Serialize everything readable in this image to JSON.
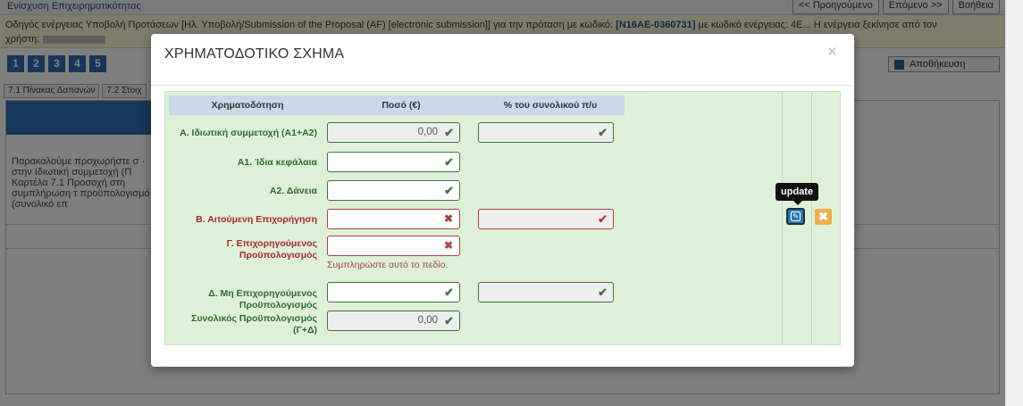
{
  "background": {
    "breadcrumb": "Ενίσχυση Επιχειρηματικότητας",
    "nav": {
      "prev": "<< Προηγούμενο",
      "next": "Επόμενο >>",
      "help": "Βοήθεια"
    },
    "info_line1": "Οδηγός ενέργειας Υποβολή Προτάσεων [Ηλ. Υποβολή/Submission of the Proposal (AF) [electronic submission]] για την πρόταση με κωδικό:",
    "proposal_code": "[N16AE-0360731]",
    "info_line1_end": "με κωδικό ενέργειας: 4Ε... Η ενέργεια ξεκίνησε από τον",
    "info_line2": "χρήστη:",
    "steps": [
      "1",
      "2",
      "3",
      "4",
      "5"
    ],
    "save_label": "Αποθήκευση",
    "tabs": [
      "7.1 Πίνακας Δαπανών",
      "7.2 Στοιχ"
    ],
    "panel_message": "Παρακαλούμε προχωρήστε σ · στην Ιδιωτική συμμετοχή (Π Καρτέλα 7.1 Προσοχή στη συμπλήρωση τ προϋπολογισμό (συνολικό επ"
  },
  "modal": {
    "title": "ΧΡΗΜΑΤΟΔΟΤΙΚΟ ΣΧΗΜΑ",
    "close_symbol": "×",
    "headers": [
      "Χρηματοδότηση",
      "Ποσό (€)",
      "% του συνολικού π/υ"
    ],
    "rows": [
      {
        "label": "Α. Ιδιωτική συμμετοχή (Α1+Α2)",
        "amount": "0,00",
        "amount_state": "ok",
        "amount_readonly": true,
        "pct": "",
        "pct_state": "ok",
        "has_pct": true,
        "label_state": "ok"
      },
      {
        "label": "Α1. Ίδια κεφάλαια",
        "amount": "",
        "amount_state": "ok",
        "amount_readonly": false,
        "has_pct": false,
        "label_state": "ok"
      },
      {
        "label": "Α2. Δάνεια",
        "amount": "",
        "amount_state": "ok",
        "amount_readonly": false,
        "has_pct": false,
        "label_state": "ok"
      },
      {
        "label": "Β. Αιτούμενη Επιχορήγηση",
        "amount": "",
        "amount_state": "error",
        "amount_readonly": false,
        "pct": "",
        "pct_state": "error",
        "has_pct": true,
        "label_state": "error"
      },
      {
        "label": "Γ. Επιχορηγούμενος Προϋπολογισμός",
        "amount": "",
        "amount_state": "error",
        "amount_readonly": false,
        "has_pct": false,
        "label_state": "error",
        "help": "Συμπληρώστε αυτό το πεδίο."
      },
      {
        "label": "Δ. Μη Επιχορηγούμενος Προϋπολογισμός",
        "amount": "",
        "amount_state": "ok",
        "amount_readonly": false,
        "pct": "",
        "pct_state": "ok",
        "has_pct": true,
        "label_state": "ok"
      },
      {
        "label": "Συνολικός Προϋπολογισμός (Γ+Δ)",
        "amount": "0,00",
        "amount_state": "ok",
        "amount_readonly": true,
        "has_pct": false,
        "label_state": "ok"
      }
    ],
    "tooltip": "update",
    "cancel_symbol": "✖",
    "update_symbol": "✎"
  },
  "colors": {
    "ok_border": "#3c763d",
    "error_border": "#a94442",
    "panel_green": "#dff0d8",
    "header_blue": "#c9d9ea"
  },
  "icons": {
    "ok": "check-icon",
    "error": "cross-icon",
    "update": "edit-icon",
    "cancel": "cancel-icon"
  }
}
